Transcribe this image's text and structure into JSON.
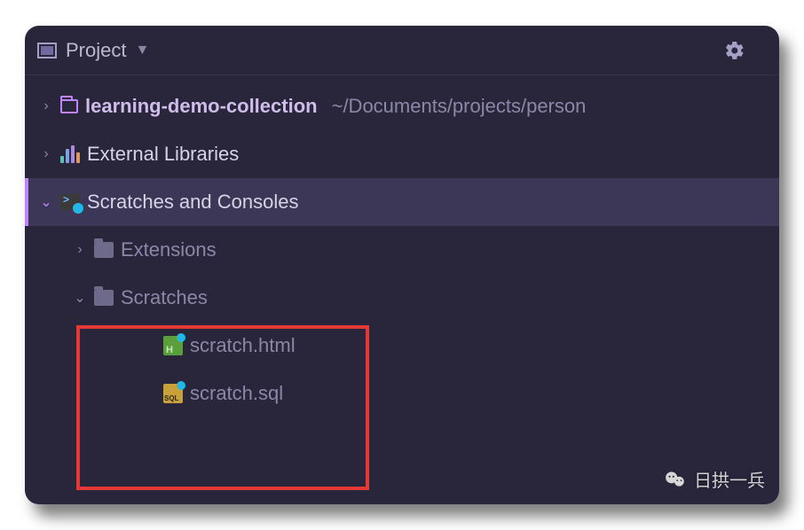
{
  "toolbar": {
    "title": "Project"
  },
  "tree": {
    "project": {
      "name": "learning-demo-collection",
      "path": "~/Documents/projects/person"
    },
    "external_libraries": "External Libraries",
    "scratches_consoles": "Scratches and Consoles",
    "extensions": "Extensions",
    "scratches": "Scratches",
    "files": {
      "html": "scratch.html",
      "sql": "scratch.sql"
    }
  },
  "watermark": "日拱一兵"
}
